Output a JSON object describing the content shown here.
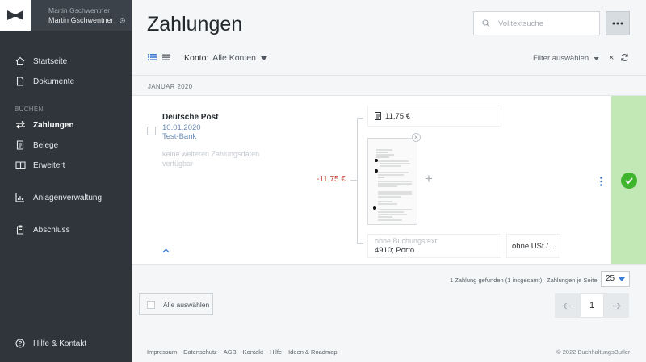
{
  "user": {
    "name_top": "Martin Gschwentner",
    "name_bottom": "Martin Gschwentner"
  },
  "nav": {
    "items": [
      {
        "label": "Startseite",
        "icon": "home-icon"
      },
      {
        "label": "Dokumente",
        "icon": "document-icon"
      },
      {
        "label": "Zahlungen",
        "icon": "transfer-icon",
        "active": true
      },
      {
        "label": "Belege",
        "icon": "receipt-icon"
      },
      {
        "label": "Erweitert",
        "icon": "book-icon"
      },
      {
        "label": "Anlagenverwaltung",
        "icon": "chart-icon"
      },
      {
        "label": "Abschluss",
        "icon": "clipboard-icon"
      },
      {
        "label": "Hilfe & Kontakt",
        "icon": "help-icon"
      }
    ],
    "section_label": "BUCHEN"
  },
  "page": {
    "title": "Zahlungen"
  },
  "search": {
    "placeholder": "Volltextsuche"
  },
  "toolbar": {
    "konto_label": "Konto:",
    "konto_value": "Alle Konten",
    "filter_label": "Filter auswählen"
  },
  "month": "JANUAR 2020",
  "payment": {
    "name": "Deutsche Post",
    "date": "10.01.2020",
    "bank": "Test-Bank",
    "no_data": "keine weiteren Zahlungsdaten verfügbar",
    "amount": "-11,75 €",
    "beleg_amount": "11,75 €",
    "buchung_placeholder": "ohne Buchungstext",
    "buchung_value": "4910; Porto",
    "ust": "ohne USt./..."
  },
  "pagination": {
    "found": "1 Zahlung gefunden (1 insgesamt)",
    "per_page_label": "Zahlungen je Seite:",
    "per_page": "25",
    "current_page": "1",
    "select_all": "Alle auswählen"
  },
  "footer": {
    "links": [
      "Impressum",
      "Datenschutz",
      "AGB",
      "Kontakt",
      "Hilfe",
      "Ideen & Roadmap"
    ],
    "copyright": "© 2022 BuchhaltungsButler"
  },
  "colors": {
    "sidebar": "#2f353b",
    "accent": "#3a7bd5",
    "success": "#3fb52d",
    "status_bg": "#c2e8b6",
    "negative": "#c0392b"
  }
}
